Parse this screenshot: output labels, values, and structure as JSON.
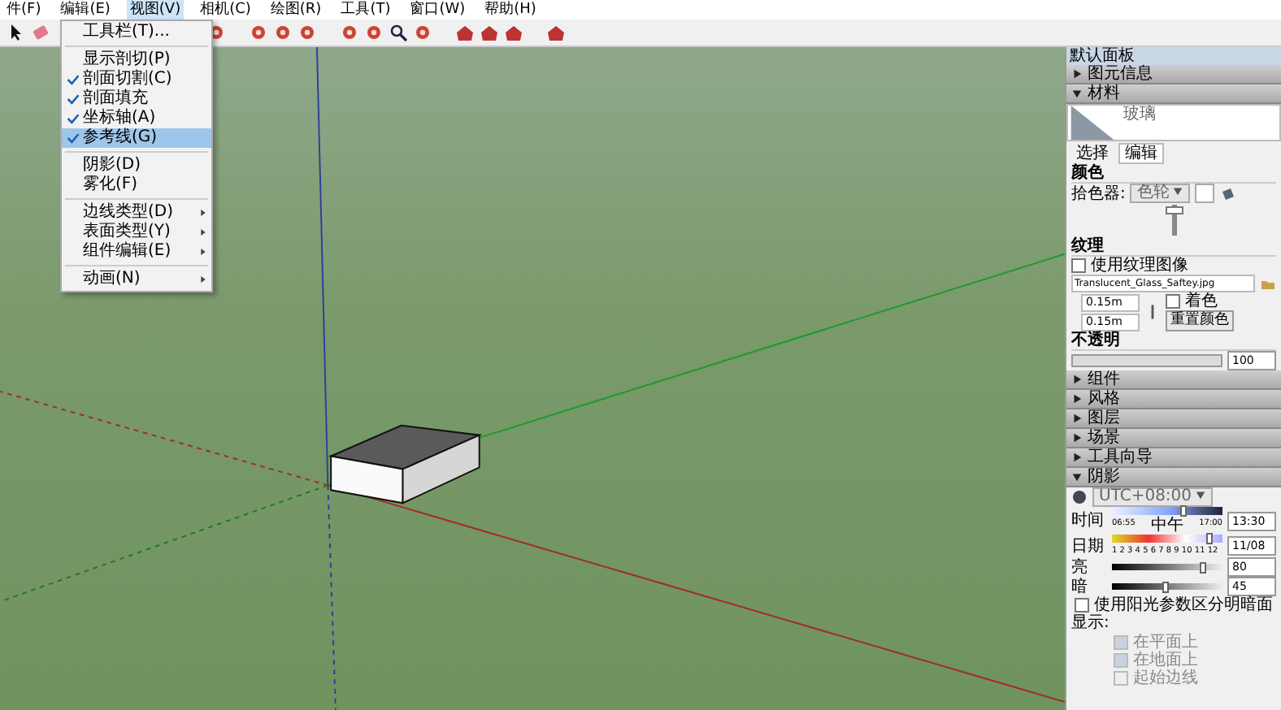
{
  "menu": [
    {
      "label": "件(F)",
      "selected": false
    },
    {
      "label": "编辑(E)",
      "selected": false
    },
    {
      "label": "视图(V)",
      "selected": true
    },
    {
      "label": "相机(C)",
      "selected": false
    },
    {
      "label": "绘图(R)",
      "selected": false
    },
    {
      "label": "工具(T)",
      "selected": false
    },
    {
      "label": "窗口(W)",
      "selected": false
    },
    {
      "label": "帮助(H)",
      "selected": false
    }
  ],
  "dropdown": [
    {
      "label": "工具栏(T)...",
      "kind": "item",
      "checked": false,
      "selected": false,
      "submenu": false
    },
    {
      "kind": "separator"
    },
    {
      "label": "显示剖切(P)",
      "kind": "item",
      "checked": false,
      "selected": false,
      "submenu": false
    },
    {
      "label": "剖面切割(C)",
      "kind": "item",
      "checked": true,
      "selected": false,
      "submenu": false
    },
    {
      "label": "剖面填充",
      "kind": "item",
      "checked": true,
      "selected": false,
      "submenu": false
    },
    {
      "label": "坐标轴(A)",
      "kind": "item",
      "checked": true,
      "selected": false,
      "submenu": false
    },
    {
      "label": "参考线(G)",
      "kind": "item",
      "checked": true,
      "selected": true,
      "submenu": false
    },
    {
      "kind": "separator"
    },
    {
      "label": "阴影(D)",
      "kind": "item",
      "checked": false,
      "selected": false,
      "submenu": false
    },
    {
      "label": "雾化(F)",
      "kind": "item",
      "checked": false,
      "selected": false,
      "submenu": false
    },
    {
      "kind": "separator"
    },
    {
      "label": "边线类型(D)",
      "kind": "item",
      "checked": false,
      "selected": false,
      "submenu": true
    },
    {
      "label": "表面类型(Y)",
      "kind": "item",
      "checked": false,
      "selected": false,
      "submenu": true
    },
    {
      "label": "组件编辑(E)",
      "kind": "item",
      "checked": false,
      "selected": false,
      "submenu": true
    },
    {
      "kind": "separator"
    },
    {
      "label": "动画(N)",
      "kind": "item",
      "checked": false,
      "selected": false,
      "submenu": true
    }
  ],
  "panel": {
    "title": "默认面板",
    "entity_info": {
      "label": "图元信息",
      "expanded": false
    },
    "materials": {
      "label": "材料",
      "expanded": true,
      "name": "玻璃",
      "tabs": [
        {
          "label": "选择",
          "selected": false
        },
        {
          "label": "编辑",
          "selected": true
        }
      ],
      "color_heading": "颜色",
      "picker_label": "拾色器:",
      "picker_value": "色轮",
      "brightness": {
        "level": 0.9
      },
      "texture_heading": "纹理",
      "use_texture": {
        "label": "使用纹理图像",
        "checked": false
      },
      "texture_file": "Translucent_Glass_Saftey.jpg",
      "width": "0.15m",
      "height": "0.15m",
      "colorize": {
        "label": "着色",
        "checked": false
      },
      "reset_label": "重置颜色",
      "opacity_heading": "不透明",
      "opacity": {
        "level": 1.0
      },
      "opacity_value": "100"
    },
    "sections": [
      {
        "label": "组件",
        "expanded": false
      },
      {
        "label": "风格",
        "expanded": false
      },
      {
        "label": "图层",
        "expanded": false
      },
      {
        "label": "场景",
        "expanded": false
      },
      {
        "label": "工具向导",
        "expanded": false
      }
    ],
    "shadows": {
      "label": "阴影",
      "expanded": true,
      "timezone": "UTC+08:00",
      "time": {
        "label": "时间",
        "level": 0.62,
        "ticks": [
          "06:55",
          "中午",
          "17:00"
        ],
        "value": "13:30"
      },
      "date": {
        "label": "日期",
        "level": 0.85,
        "ticks": [
          "1 2 3 4 5 6 7 8 9 10 11 12"
        ],
        "value": "11/08"
      },
      "light": {
        "label": "亮",
        "level": 0.8,
        "value": "80"
      },
      "dark": {
        "label": "暗",
        "level": 0.45,
        "value": "45"
      },
      "use_sun": {
        "label": "使用阳光参数区分明暗面",
        "checked": false
      },
      "display_label": "显示:",
      "display": [
        {
          "label": "在平面上",
          "checked": true,
          "disabled": true
        },
        {
          "label": "在地面上",
          "checked": true,
          "disabled": true
        },
        {
          "label": "起始边线",
          "checked": false,
          "disabled": true
        }
      ]
    }
  }
}
